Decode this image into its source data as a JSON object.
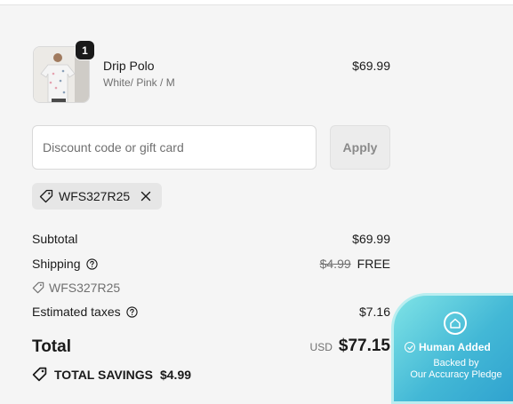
{
  "product": {
    "name": "Drip Polo",
    "variant": "White/ Pink / M",
    "price": "$69.99",
    "quantity": "1",
    "image_icon": "polo-shirt-thumbnail"
  },
  "discount": {
    "placeholder": "Discount code or gift card",
    "value": "",
    "apply_label": "Apply"
  },
  "applied_chip": {
    "code": "WFS327R25",
    "icon": "tag-icon",
    "remove_icon": "close-icon"
  },
  "summary": {
    "subtotal_label": "Subtotal",
    "subtotal_value": "$69.99",
    "shipping_label": "Shipping",
    "shipping_original": "$4.99",
    "shipping_value": "FREE",
    "shipping_code": "WFS327R25",
    "taxes_label": "Estimated taxes",
    "taxes_value": "$7.16"
  },
  "total": {
    "label": "Total",
    "currency": "USD",
    "amount": "$77.15"
  },
  "savings": {
    "label": "TOTAL SAVINGS",
    "amount": "$4.99"
  },
  "pledge": {
    "title": "Human Added",
    "line1": "Backed by",
    "line2": "Our Accuracy Pledge"
  },
  "colors": {
    "text": "#1a1a1a",
    "muted": "#707070",
    "widget": "#43b8d6"
  }
}
